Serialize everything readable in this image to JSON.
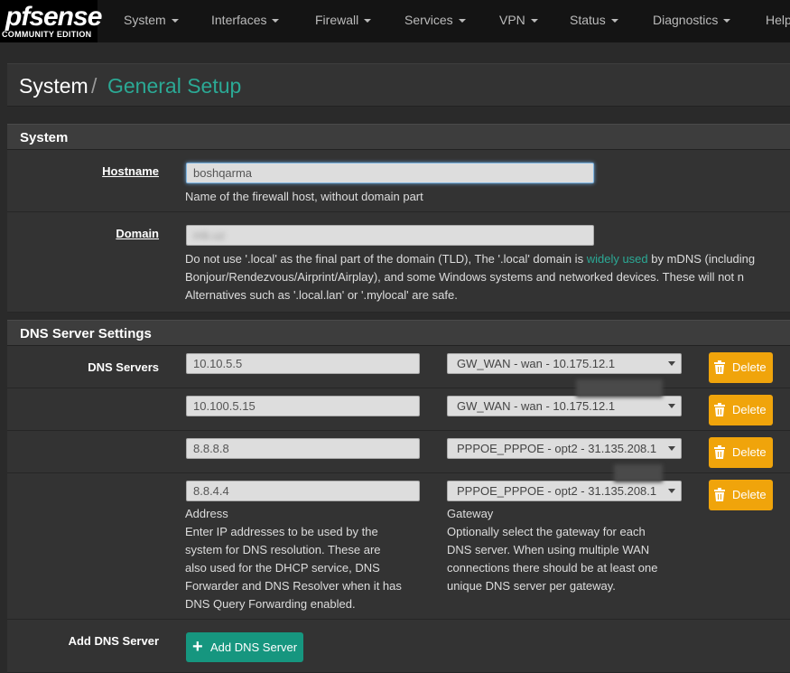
{
  "brand": {
    "logo": "pfsense",
    "edition": "COMMUNITY EDITION"
  },
  "nav": {
    "items": [
      {
        "label": "System"
      },
      {
        "label": "Interfaces"
      },
      {
        "label": "Firewall"
      },
      {
        "label": "Services"
      },
      {
        "label": "VPN"
      },
      {
        "label": "Status"
      },
      {
        "label": "Diagnostics"
      },
      {
        "label": "Help"
      }
    ]
  },
  "breadcrumb": {
    "root": "System",
    "separator": "/",
    "current": "General Setup"
  },
  "system_panel": {
    "title": "System",
    "hostname": {
      "label": "Hostname",
      "value": "boshqarma",
      "help": "Name of the firewall host, without domain part"
    },
    "domain": {
      "label": "Domain",
      "value": "mb.uz",
      "help_1": "Do not use '.local' as the final part of the domain (TLD), The '.local' domain is",
      "help_link": "widely used",
      "help_2": "by mDNS (including",
      "help_3": "Bonjour/Rendezvous/Airprint/Airplay), and some Windows systems and networked devices. These will not n",
      "help_4": "Alternatives such as '.local.lan' or '.mylocal' are safe."
    }
  },
  "dns_panel": {
    "title": "DNS Server Settings",
    "label": "DNS Servers",
    "servers": [
      {
        "address": "10.10.5.5",
        "gateway": "GW_WAN - wan - 10.175.12.1",
        "delete": "Delete"
      },
      {
        "address": "10.100.5.15",
        "gateway": "GW_WAN - wan - 10.175.12.1",
        "delete": "Delete"
      },
      {
        "address": "8.8.8.8",
        "gateway": "PPPOE_PPPOE - opt2 - 31.135.208.1",
        "delete": "Delete"
      },
      {
        "address": "8.8.4.4",
        "gateway": "PPPOE_PPPOE - opt2 - 31.135.208.1",
        "delete": "Delete"
      }
    ],
    "address_help": {
      "title": "Address",
      "l1": "Enter IP addresses to be used by the",
      "l2": "system for DNS resolution. These are",
      "l3": "also used for the DHCP service, DNS",
      "l4": "Forwarder and DNS Resolver when it has",
      "l5": "DNS Query Forwarding enabled."
    },
    "gateway_help": {
      "title": "Gateway",
      "l1": "Optionally select the gateway for each",
      "l2": "DNS server. When using multiple WAN",
      "l3": "connections there should be at least one",
      "l4": "unique DNS server per gateway."
    },
    "add_label": "Add DNS Server",
    "add_button": "Add DNS Server"
  },
  "colors": {
    "accent": "#2ba995",
    "delete": "#f0a40b",
    "add": "#16967f"
  }
}
